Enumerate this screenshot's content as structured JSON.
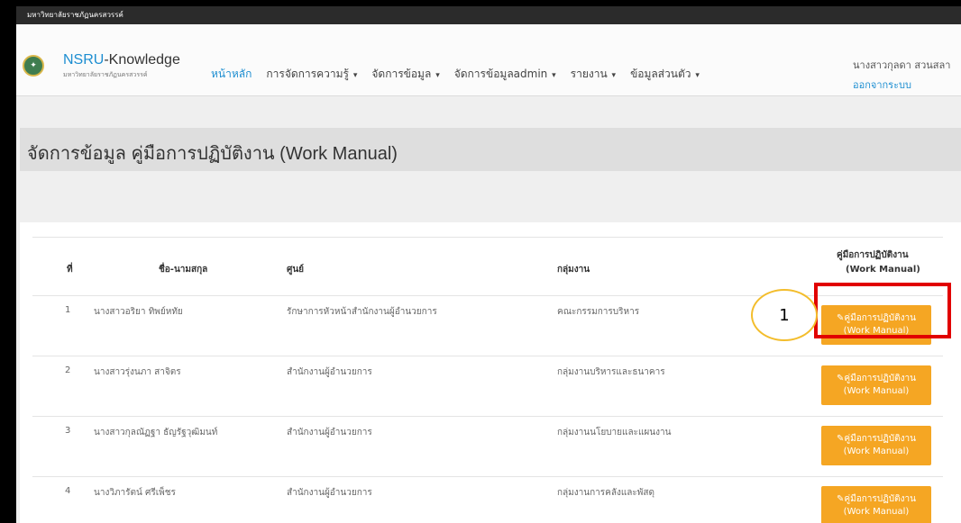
{
  "topbar": {
    "text": "มหาวิทยาลัยราชภัฏนครสวรรค์"
  },
  "brand": {
    "name_part1": "NSRU",
    "name_part2": "-Knowledge",
    "subtitle": "มหาวิทยาลัยราชภัฏนครสวรรค์"
  },
  "menu": [
    {
      "label": "หน้าหลัก",
      "active": true,
      "dropdown": false
    },
    {
      "label": "การจัดการความรู้",
      "active": false,
      "dropdown": true
    },
    {
      "label": "จัดการข้อมูล",
      "active": false,
      "dropdown": true
    },
    {
      "label": "จัดการข้อมูลadmin",
      "active": false,
      "dropdown": true
    },
    {
      "label": "รายงาน",
      "active": false,
      "dropdown": true
    },
    {
      "label": "ข้อมูลส่วนตัว",
      "active": false,
      "dropdown": true
    }
  ],
  "user": {
    "name": "นางสาวกุลดา สวนสลา",
    "logout": "ออกจากระบบ"
  },
  "page": {
    "title": "จัดการข้อมูล คู่มือการปฏิบัติงาน (Work Manual)"
  },
  "table": {
    "headers": {
      "no": "ที่",
      "name": "ชื่อ-นามสกุล",
      "center": "ศูนย์",
      "group": "กลุ่มงาน",
      "manual_line1": "คู่มือการปฏิบัติงาน",
      "manual_line2": "(Work Manual)"
    },
    "button_line1": "คู่มือการปฏิบัติงาน",
    "button_line2": "(Work Manual)",
    "rows": [
      {
        "no": "1",
        "name": "นางสาวอริยา ทิพย์หทัย",
        "center": "รักษาการหัวหน้าสำนักงานผู้อำนวยการ",
        "group": "คณะกรรมการบริหาร"
      },
      {
        "no": "2",
        "name": "นางสาวรุ่งนภา สาจิตร",
        "center": "สำนักงานผู้อำนวยการ",
        "group": "กลุ่มงานบริหารและธนาคาร"
      },
      {
        "no": "3",
        "name": "นางสาวกุลณัฏฐา ธัญรัฐวุฒิมนท์",
        "center": "สำนักงานผู้อำนวยการ",
        "group": "กลุ่มงานนโยบายและแผนงาน"
      },
      {
        "no": "4",
        "name": "นางวิภารัตน์ ศรีเพ็ชร",
        "center": "สำนักงานผู้อำนวยการ",
        "group": "กลุ่มงานการคลังและพัสดุ"
      }
    ]
  },
  "annotation": {
    "marker": "1"
  },
  "colors": {
    "accent": "#1d8ed1",
    "button": "#f5a623",
    "highlight": "#e10000"
  }
}
